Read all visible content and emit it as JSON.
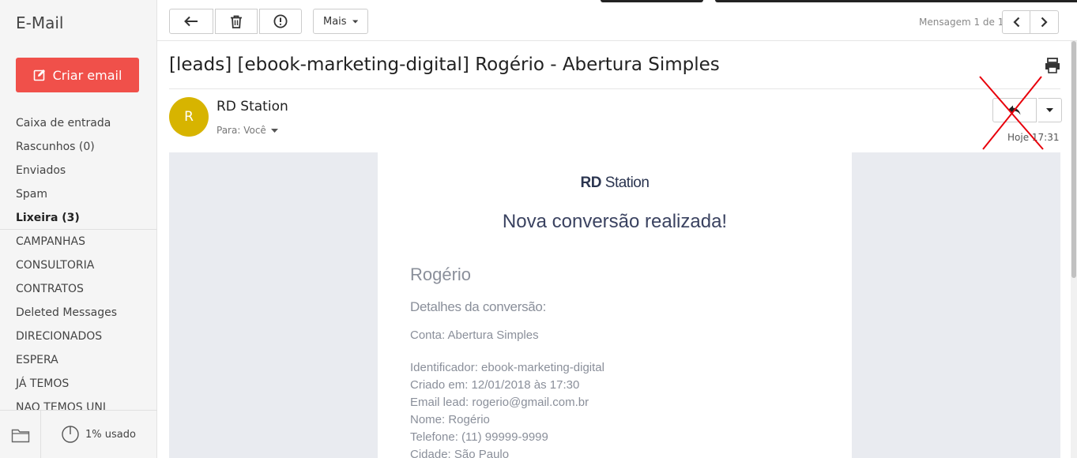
{
  "sidebar": {
    "app_title": "E-Mail",
    "compose_label": "Criar email",
    "folders": [
      {
        "label": "Caixa de entrada"
      },
      {
        "label": "Rascunhos (0)"
      },
      {
        "label": "Enviados"
      },
      {
        "label": "Spam"
      },
      {
        "label": "Lixeira (3)",
        "bold": true
      },
      {
        "label": "CAMPANHAS"
      },
      {
        "label": "CONSULTORIA"
      },
      {
        "label": "CONTRATOS"
      },
      {
        "label": "Deleted Messages"
      },
      {
        "label": "DIRECIONADOS"
      },
      {
        "label": "ESPERA"
      },
      {
        "label": "JÁ TEMOS"
      },
      {
        "label": "NAO TEMOS UNI"
      }
    ],
    "storage_usage": "1% usado"
  },
  "toolbar": {
    "more_label": "Mais",
    "message_count": "Mensagem 1 de 1"
  },
  "message": {
    "subject": "[leads] [ebook-marketing-digital] Rogério - Abertura Simples",
    "avatar_initial": "R",
    "sender": "RD Station",
    "to_label": "Para: Você",
    "date": "Hoje 17:31"
  },
  "email_body": {
    "brand_bold": "RD",
    "brand_rest": "Station",
    "headline": "Nova conversão realizada!",
    "lead_name": "Rogério",
    "details_title": "Detalhes da conversão:",
    "account": "Conta: Abertura Simples",
    "fields": [
      "Identificador: ebook-marketing-digital",
      "Criado em: 12/01/2018 às 17:30",
      "Email lead: rogerio@gmail.com.br",
      "Nome: Rogério",
      "Telefone: (11) 99999-9999",
      "Cidade: São Paulo"
    ]
  },
  "colors": {
    "compose": "#f0504a",
    "avatar": "#d7b400",
    "email_frame": "#e9ebf0",
    "annotation_x": "#e8000b"
  },
  "icons": [
    "compose-icon",
    "back-arrow-icon",
    "trash-icon",
    "alert-icon",
    "caret-down-icon",
    "chevron-left-icon",
    "chevron-right-icon",
    "print-icon",
    "reply-icon",
    "folder-icon",
    "storage-pie-icon"
  ]
}
